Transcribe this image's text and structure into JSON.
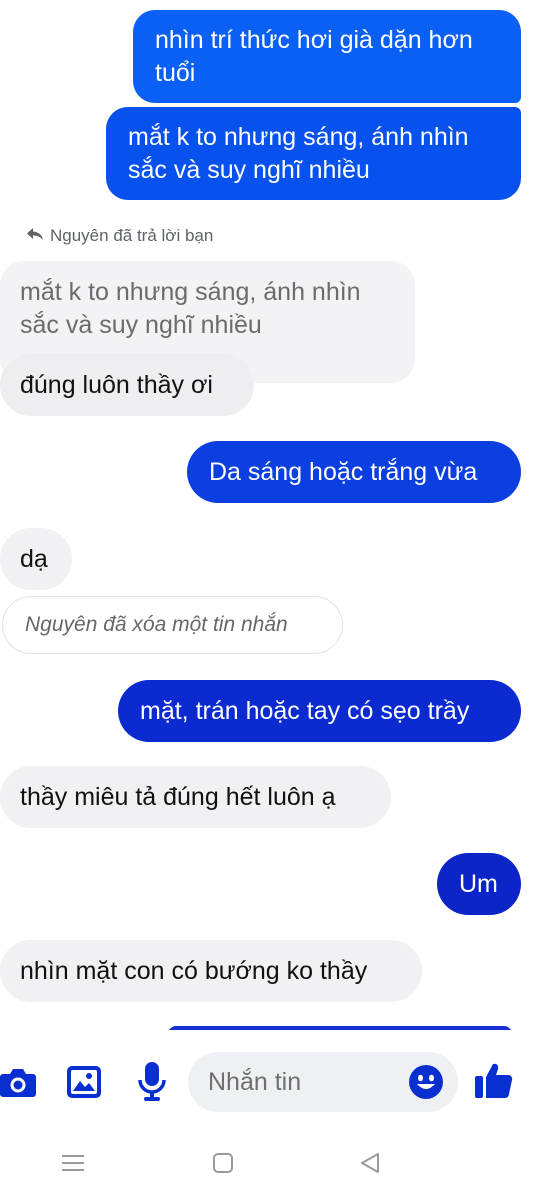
{
  "messages": {
    "out_1": {
      "lines": [
        "nhìn trí thức hơi già dặn hơn",
        "tuổi"
      ]
    },
    "out_2": {
      "lines": [
        "mắt k to nhưng sáng, ánh nhìn",
        "sắc và suy nghĩ nhiều"
      ]
    },
    "reply_note": "Nguyên đã trả lời bạn",
    "quoted": {
      "lines": [
        "mắt k to nhưng sáng, ánh nhìn",
        "sắc và suy nghĩ nhiều"
      ]
    },
    "in_1": "đúng luôn thầy ơi",
    "out_3": "Da sáng hoặc trắng vừa",
    "in_2": "dạ",
    "deleted_note": "Nguyên đã xóa một tin nhắn",
    "out_4": "mặt, trán hoặc tay có sẹo trầy",
    "in_3": "thầy miêu tả đúng hết luôn ạ",
    "out_5": "Um",
    "in_4": "nhìn mặt con có bướng ko thầy"
  },
  "composer": {
    "placeholder": "Nhắn tin",
    "icons": [
      "camera-icon",
      "image-icon",
      "microphone-icon",
      "emoji-icon",
      "thumbs-up-icon"
    ]
  },
  "navbar": {
    "icons": [
      "menu-icon",
      "home-icon",
      "back-icon"
    ]
  },
  "colors": {
    "bubble_out_top": "#0a60f5",
    "bubble_out_bottom": "#0b25c9",
    "bubble_in": "#f1f1f3",
    "accent": "#0a2fd1"
  }
}
